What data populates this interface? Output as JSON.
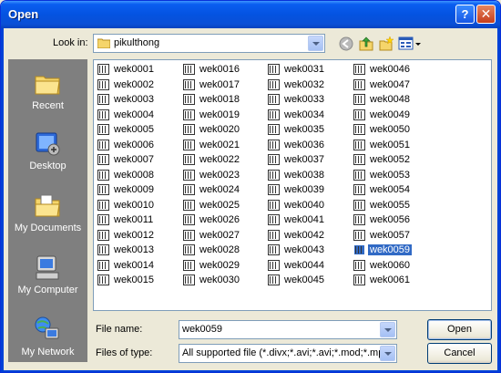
{
  "window": {
    "title": "Open",
    "help_label": "?",
    "close_label": "✕"
  },
  "lookin": {
    "label": "Look in:",
    "value": "pikulthong"
  },
  "toolbar": {
    "icons": [
      "back-icon",
      "up-folder-icon",
      "new-folder-icon",
      "views-menu-icon"
    ]
  },
  "places": [
    {
      "label": "Recent",
      "icon": "recent-documents-icon"
    },
    {
      "label": "Desktop",
      "icon": "desktop-icon"
    },
    {
      "label": "My Documents",
      "icon": "my-documents-icon"
    },
    {
      "label": "My Computer",
      "icon": "my-computer-icon"
    },
    {
      "label": "My Network",
      "icon": "my-network-icon"
    }
  ],
  "files": {
    "columns": [
      [
        "wek0001",
        "wek0002",
        "wek0003",
        "wek0004",
        "wek0005",
        "wek0006",
        "wek0007",
        "wek0008",
        "wek0009",
        "wek0010",
        "wek0011",
        "wek0012",
        "wek0013",
        "wek0014",
        "wek0015"
      ],
      [
        "wek0016",
        "wek0017",
        "wek0018",
        "wek0019",
        "wek0020",
        "wek0021",
        "wek0022",
        "wek0023",
        "wek0024",
        "wek0025",
        "wek0026",
        "wek0027",
        "wek0028",
        "wek0029",
        "wek0030"
      ],
      [
        "wek0031",
        "wek0032",
        "wek0033",
        "wek0034",
        "wek0035",
        "wek0036",
        "wek0037",
        "wek0038",
        "wek0039",
        "wek0040",
        "wek0041",
        "wek0042",
        "wek0043",
        "wek0044",
        "wek0045"
      ],
      [
        "wek0046",
        "wek0047",
        "wek0048",
        "wek0049",
        "wek0050",
        "wek0051",
        "wek0052",
        "wek0053",
        "wek0054",
        "wek0055",
        "wek0056",
        "wek0057",
        "wek0059",
        "wek0060",
        "wek0061"
      ]
    ],
    "selected": "wek0059"
  },
  "filename": {
    "label": "File name:",
    "value": "wek0059"
  },
  "filetype": {
    "label": "Files of type:",
    "value": "All supported file (*.divx;*.avi;*.avi;*.mod;*.mpg;*"
  },
  "buttons": {
    "open": "Open",
    "cancel": "Cancel"
  },
  "colors": {
    "title_bar": "#0453e1",
    "selection": "#316ac5",
    "places_bg": "#7f7f7f",
    "dialog_bg": "#ece9d8"
  }
}
